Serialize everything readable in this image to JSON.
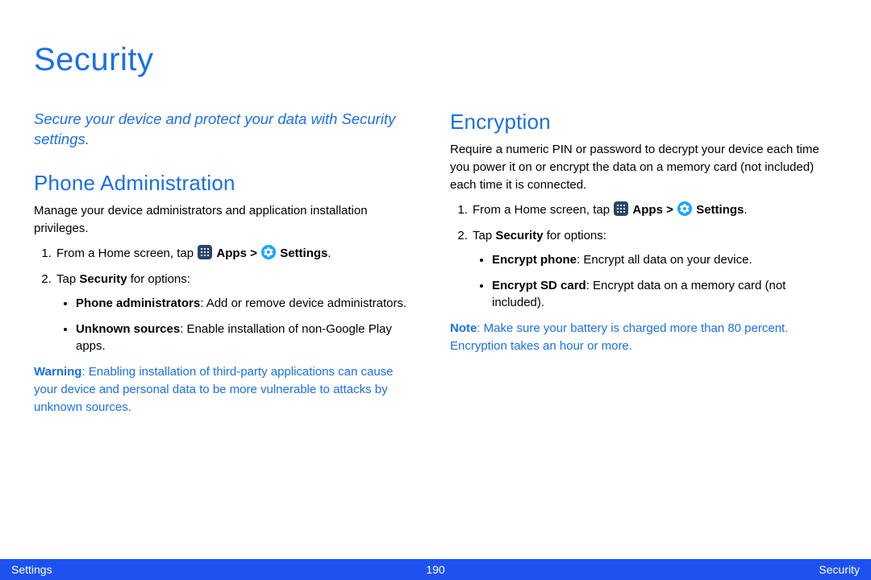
{
  "title": "Security",
  "intro": "Secure your device and protect your data with Security settings.",
  "left": {
    "heading": "Phone Administration",
    "desc": "Manage your device administrators and application installation privileges.",
    "step1_pre": "From a Home screen, tap ",
    "step1_apps": "Apps",
    "step1_gt": " > ",
    "step1_settings": "Settings",
    "step1_dot": ".",
    "step2_pre": "Tap ",
    "step2_bold": "Security",
    "step2_post": " for options:",
    "bullet1_bold": "Phone administrators",
    "bullet1_post": ": Add or remove device administrators.",
    "bullet2_bold": "Unknown sources",
    "bullet2_post": ": Enable installation of non‑Google Play apps.",
    "warn_label": "Warning",
    "warn_text": ": Enabling installation of third-party applications can cause your device and personal data to be more vulnerable to attacks by unknown sources."
  },
  "right": {
    "heading": "Encryption",
    "desc": "Require a numeric PIN or password to decrypt your device each time you power it on or encrypt the data on a memory card (not included) each time it is connected.",
    "step1_pre": "From a Home screen, tap ",
    "step1_apps": "Apps",
    "step1_gt": " > ",
    "step1_settings": "Settings",
    "step1_dot": ".",
    "step2_pre": "Tap ",
    "step2_bold": "Security",
    "step2_post": " for options:",
    "bullet1_bold": "Encrypt phone",
    "bullet1_post": ": Encrypt all data on your device.",
    "bullet2_bold": "Encrypt SD card",
    "bullet2_post": ": Encrypt data on a memory card (not included).",
    "note_label": "Note",
    "note_text": ": Make sure your battery is charged more than 80 percent. Encryption takes an hour or more."
  },
  "footer": {
    "left": "Settings",
    "center": "190",
    "right": "Security"
  }
}
